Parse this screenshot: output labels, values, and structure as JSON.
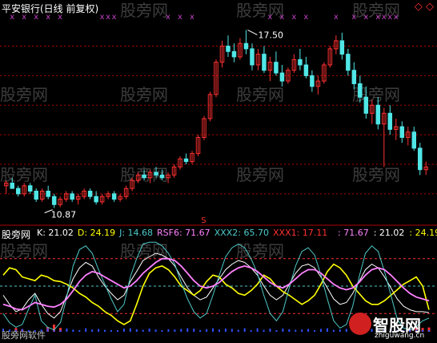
{
  "window": {
    "title": "平安银行(日线 前复权)",
    "watermark": "股旁网",
    "footer_left": "股旁网软件",
    "footer_logo": "智股网",
    "footer_url": "zhiguwang.cn",
    "diamond_icon": "diamond-icon"
  },
  "colors": {
    "background": "#000000",
    "up": "#ff3030",
    "down": "#50e6e6",
    "grid": "#b00000",
    "k_line": "#ffffff",
    "d_line": "#ffff00",
    "j_line": "#4ec9c9",
    "rsf_line": "#ff80ff",
    "xxx2_line": "#4ec9c9",
    "xxx1_line": "#ff3030",
    "marker_x": "#c040c0",
    "watermark": "#6e6e6e"
  },
  "chart_data": [
    {
      "type": "candlestick",
      "title": "平安银行(日线 前复权)",
      "annotations": [
        {
          "label": "17.50",
          "kind": "high"
        },
        {
          "label": "10.87",
          "kind": "low"
        }
      ],
      "signal_label": "S",
      "top_markers": "x",
      "ylim": [
        10.5,
        18.2
      ],
      "grid_prices": [
        11.4,
        12.5,
        13.6,
        14.7,
        15.8,
        16.9
      ],
      "candles": [
        {
          "o": 11.7,
          "h": 11.9,
          "l": 11.4,
          "c": 11.8
        },
        {
          "o": 11.8,
          "h": 12.0,
          "l": 11.6,
          "c": 11.6
        },
        {
          "o": 11.6,
          "h": 11.7,
          "l": 11.3,
          "c": 11.4
        },
        {
          "o": 11.4,
          "h": 11.8,
          "l": 11.3,
          "c": 11.7
        },
        {
          "o": 11.7,
          "h": 11.8,
          "l": 11.4,
          "c": 11.5
        },
        {
          "o": 11.5,
          "h": 11.6,
          "l": 11.1,
          "c": 11.2
        },
        {
          "o": 11.2,
          "h": 11.6,
          "l": 11.1,
          "c": 11.5
        },
        {
          "o": 11.5,
          "h": 11.7,
          "l": 11.2,
          "c": 11.3
        },
        {
          "o": 11.3,
          "h": 11.4,
          "l": 10.87,
          "c": 11.0
        },
        {
          "o": 11.0,
          "h": 11.3,
          "l": 10.9,
          "c": 11.2
        },
        {
          "o": 11.2,
          "h": 11.5,
          "l": 11.1,
          "c": 11.4
        },
        {
          "o": 11.4,
          "h": 11.5,
          "l": 11.1,
          "c": 11.2
        },
        {
          "o": 11.2,
          "h": 11.4,
          "l": 11.0,
          "c": 11.3
        },
        {
          "o": 11.3,
          "h": 11.6,
          "l": 11.2,
          "c": 11.5
        },
        {
          "o": 11.5,
          "h": 11.6,
          "l": 11.2,
          "c": 11.3
        },
        {
          "o": 11.3,
          "h": 11.5,
          "l": 11.0,
          "c": 11.1
        },
        {
          "o": 11.1,
          "h": 11.4,
          "l": 11.0,
          "c": 11.3
        },
        {
          "o": 11.3,
          "h": 11.5,
          "l": 11.2,
          "c": 11.4
        },
        {
          "o": 11.4,
          "h": 11.5,
          "l": 11.1,
          "c": 11.2
        },
        {
          "o": 11.2,
          "h": 11.4,
          "l": 11.1,
          "c": 11.3
        },
        {
          "o": 11.3,
          "h": 11.7,
          "l": 11.2,
          "c": 11.6
        },
        {
          "o": 11.6,
          "h": 12.0,
          "l": 11.5,
          "c": 11.9
        },
        {
          "o": 11.9,
          "h": 12.2,
          "l": 11.8,
          "c": 12.1
        },
        {
          "o": 12.1,
          "h": 12.3,
          "l": 11.9,
          "c": 12.0
        },
        {
          "o": 12.0,
          "h": 12.3,
          "l": 11.8,
          "c": 12.2
        },
        {
          "o": 12.2,
          "h": 12.4,
          "l": 12.0,
          "c": 12.1
        },
        {
          "o": 12.1,
          "h": 12.3,
          "l": 11.9,
          "c": 12.0
        },
        {
          "o": 12.0,
          "h": 12.2,
          "l": 11.8,
          "c": 12.1
        },
        {
          "o": 12.1,
          "h": 12.5,
          "l": 12.0,
          "c": 12.4
        },
        {
          "o": 12.4,
          "h": 12.8,
          "l": 12.3,
          "c": 12.7
        },
        {
          "o": 12.7,
          "h": 12.9,
          "l": 12.5,
          "c": 12.6
        },
        {
          "o": 12.6,
          "h": 13.0,
          "l": 12.5,
          "c": 12.9
        },
        {
          "o": 12.9,
          "h": 13.6,
          "l": 12.8,
          "c": 13.5
        },
        {
          "o": 13.5,
          "h": 14.3,
          "l": 13.4,
          "c": 14.2
        },
        {
          "o": 14.2,
          "h": 15.2,
          "l": 14.1,
          "c": 15.1
        },
        {
          "o": 15.1,
          "h": 16.4,
          "l": 15.0,
          "c": 16.3
        },
        {
          "o": 16.3,
          "h": 17.1,
          "l": 16.1,
          "c": 16.9
        },
        {
          "o": 16.9,
          "h": 17.3,
          "l": 16.5,
          "c": 16.7
        },
        {
          "o": 16.7,
          "h": 17.0,
          "l": 16.3,
          "c": 16.5
        },
        {
          "o": 16.5,
          "h": 17.2,
          "l": 16.4,
          "c": 17.0
        },
        {
          "o": 17.0,
          "h": 17.5,
          "l": 16.6,
          "c": 16.8
        },
        {
          "o": 16.8,
          "h": 17.0,
          "l": 16.0,
          "c": 16.2
        },
        {
          "o": 16.2,
          "h": 16.8,
          "l": 16.0,
          "c": 16.6
        },
        {
          "o": 16.6,
          "h": 16.9,
          "l": 15.9,
          "c": 16.0
        },
        {
          "o": 16.0,
          "h": 16.5,
          "l": 15.6,
          "c": 16.3
        },
        {
          "o": 16.3,
          "h": 16.7,
          "l": 15.8,
          "c": 15.9
        },
        {
          "o": 15.9,
          "h": 16.2,
          "l": 15.4,
          "c": 15.6
        },
        {
          "o": 15.6,
          "h": 16.1,
          "l": 15.5,
          "c": 16.0
        },
        {
          "o": 16.0,
          "h": 16.6,
          "l": 15.9,
          "c": 16.4
        },
        {
          "o": 16.4,
          "h": 16.8,
          "l": 16.0,
          "c": 16.2
        },
        {
          "o": 16.2,
          "h": 16.5,
          "l": 15.7,
          "c": 15.8
        },
        {
          "o": 15.8,
          "h": 16.0,
          "l": 15.2,
          "c": 15.4
        },
        {
          "o": 15.4,
          "h": 15.8,
          "l": 15.1,
          "c": 15.6
        },
        {
          "o": 15.6,
          "h": 16.3,
          "l": 15.5,
          "c": 16.2
        },
        {
          "o": 16.2,
          "h": 16.9,
          "l": 16.1,
          "c": 16.8
        },
        {
          "o": 16.8,
          "h": 17.3,
          "l": 16.6,
          "c": 17.1
        },
        {
          "o": 17.1,
          "h": 17.4,
          "l": 16.4,
          "c": 16.6
        },
        {
          "o": 16.6,
          "h": 16.8,
          "l": 15.8,
          "c": 16.0
        },
        {
          "o": 16.0,
          "h": 16.3,
          "l": 15.3,
          "c": 15.5
        },
        {
          "o": 15.5,
          "h": 15.8,
          "l": 14.8,
          "c": 15.0
        },
        {
          "o": 15.0,
          "h": 15.4,
          "l": 14.2,
          "c": 14.4
        },
        {
          "o": 14.4,
          "h": 14.9,
          "l": 14.0,
          "c": 14.7
        },
        {
          "o": 14.7,
          "h": 15.0,
          "l": 13.8,
          "c": 14.0
        },
        {
          "o": 14.0,
          "h": 14.6,
          "l": 12.4,
          "c": 14.4
        },
        {
          "o": 14.4,
          "h": 14.7,
          "l": 13.6,
          "c": 13.8
        },
        {
          "o": 13.8,
          "h": 14.2,
          "l": 13.4,
          "c": 13.9
        },
        {
          "o": 13.9,
          "h": 14.1,
          "l": 13.3,
          "c": 13.5
        },
        {
          "o": 13.5,
          "h": 13.9,
          "l": 13.2,
          "c": 13.7
        },
        {
          "o": 13.7,
          "h": 13.9,
          "l": 13.0,
          "c": 13.1
        },
        {
          "o": 13.1,
          "h": 13.3,
          "l": 12.1,
          "c": 12.3
        },
        {
          "o": 12.3,
          "h": 12.6,
          "l": 12.1,
          "c": 12.4
        }
      ]
    },
    {
      "type": "line",
      "title": "股旁网",
      "legend": [
        {
          "name": "K",
          "value": "21.02",
          "color": "#ffffff"
        },
        {
          "name": "D",
          "value": "24.19",
          "color": "#ffff00"
        },
        {
          "name": "J",
          "value": "14.68",
          "color": "#4ec9c9"
        },
        {
          "name": "RSF6",
          "value": "71.67",
          "color": "#ff80ff"
        },
        {
          "name": "XXX2",
          "value": "65.70",
          "color": "#4ec9c9"
        },
        {
          "name": "XXX1",
          "value": "17.11",
          "color": "#ff3030"
        }
      ],
      "legend_tail": [
        {
          "value": "71.67",
          "color": "#ff80ff"
        },
        {
          "value": "21.02",
          "color": "#ffffff"
        },
        {
          "value": "24.19",
          "color": "#ffff00"
        }
      ],
      "ylim": [
        0,
        100
      ],
      "levels": [
        80,
        50,
        20
      ],
      "series": [
        {
          "name": "K",
          "values": [
            40,
            30,
            22,
            25,
            35,
            42,
            30,
            20,
            15,
            22,
            40,
            58,
            70,
            76,
            72,
            60,
            50,
            42,
            35,
            40,
            55,
            66,
            78,
            82,
            86,
            84,
            80,
            72,
            60,
            48,
            40,
            35,
            38,
            48,
            58,
            68,
            74,
            78,
            76,
            70,
            62,
            50,
            40,
            35,
            40,
            52,
            64,
            72,
            74,
            70,
            60,
            48,
            36,
            30,
            32,
            42,
            55,
            68,
            74,
            70,
            60,
            48,
            36,
            28,
            24,
            22,
            22,
            21
          ]
        },
        {
          "name": "D",
          "values": [
            62,
            70,
            68,
            60,
            58,
            56,
            62,
            60,
            56,
            55,
            52,
            48,
            42,
            38,
            32,
            28,
            22,
            18,
            12,
            8,
            12,
            30,
            50,
            64,
            70,
            72,
            68,
            60,
            50,
            45,
            40,
            45,
            55,
            62,
            60,
            52,
            48,
            42,
            40,
            45,
            52,
            62,
            58,
            50,
            44,
            40,
            35,
            30,
            34,
            40,
            52,
            66,
            74,
            70,
            62,
            50,
            42,
            34,
            30,
            30,
            34,
            40,
            46,
            52,
            56,
            60,
            50,
            24
          ]
        },
        {
          "name": "J",
          "values": [
            20,
            10,
            5,
            8,
            25,
            40,
            12,
            5,
            2,
            10,
            38,
            72,
            90,
            94,
            86,
            68,
            52,
            36,
            22,
            30,
            60,
            80,
            96,
            98,
            98,
            94,
            86,
            74,
            54,
            36,
            22,
            15,
            20,
            40,
            62,
            82,
            92,
            96,
            92,
            80,
            64,
            40,
            20,
            12,
            22,
            48,
            72,
            88,
            92,
            84,
            62,
            36,
            12,
            4,
            8,
            28,
            60,
            86,
            94,
            88,
            66,
            40,
            14,
            4,
            2,
            6,
            12,
            15
          ]
        },
        {
          "name": "RSF6",
          "values": [
            30,
            28,
            25,
            24,
            28,
            32,
            30,
            28,
            27,
            30,
            36,
            45,
            55,
            62,
            66,
            64,
            60,
            56,
            52,
            48,
            50,
            56,
            64,
            70,
            76,
            80,
            80,
            78,
            72,
            64,
            56,
            50,
            48,
            50,
            54,
            60,
            66,
            70,
            72,
            70,
            66,
            60,
            54,
            50,
            48,
            52,
            58,
            64,
            68,
            68,
            64,
            58,
            52,
            48,
            46,
            48,
            54,
            62,
            68,
            70,
            68,
            62,
            55,
            48,
            42,
            38,
            36,
            34
          ]
        }
      ],
      "bars_blue_name": "XXX2",
      "bars_red_name": "XXX1"
    }
  ]
}
